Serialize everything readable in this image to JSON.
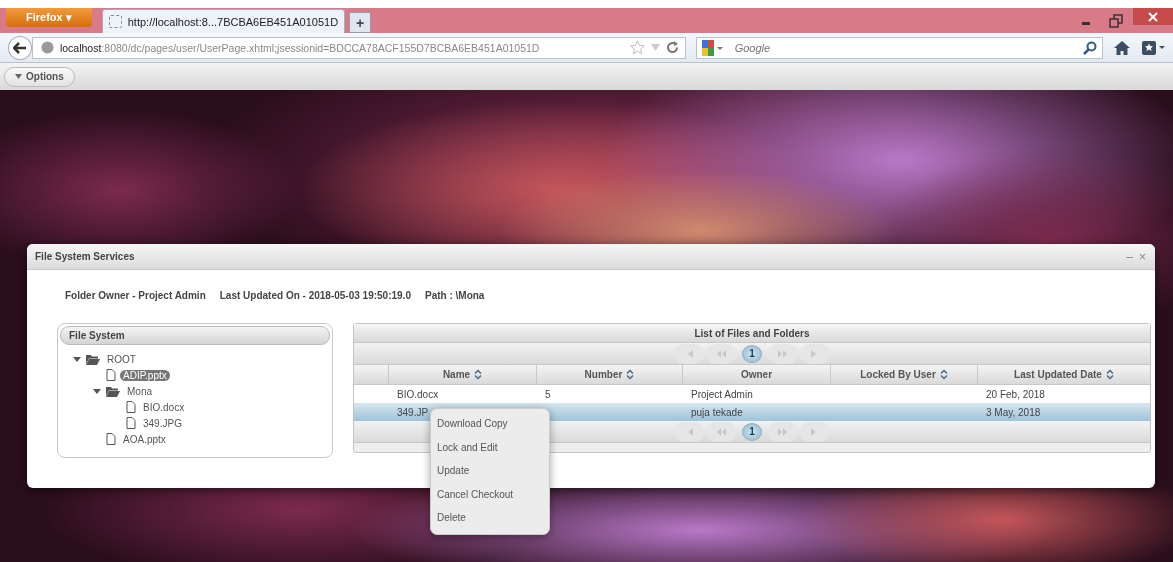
{
  "browser": {
    "menu_button": "Firefox ▾",
    "tab_title": "http://localhost:8...7BCBA6EB451A01051D",
    "new_tab": "+",
    "url_host": "localhost",
    "url_rest": ":8080/dc/pages/user/UserPage.xhtml;jsessionid=BDCCA78ACF155D7BCBA6EB451A01051D",
    "search_placeholder": "Google",
    "options_button": "Options"
  },
  "dialog": {
    "title": "File System Services",
    "controls": [
      "–",
      "×"
    ],
    "info": [
      "Folder Owner - Project Admin",
      "Last Updated On - 2018-05-03 19:50:19.0",
      "Path : \\Mona"
    ],
    "tree": {
      "title": "File System",
      "items": [
        {
          "label": "ROOT",
          "kind": "folder",
          "expanded": true,
          "selected": false,
          "children": [
            {
              "label": "ADIP.pptx",
              "kind": "file",
              "selected": true
            },
            {
              "label": "Mona",
              "kind": "folder",
              "expanded": true,
              "selected": false,
              "children": [
                {
                  "label": "BIO.docx",
                  "kind": "file",
                  "selected": false
                },
                {
                  "label": "349.JPG",
                  "kind": "file",
                  "selected": false
                }
              ]
            },
            {
              "label": "AOA.pptx",
              "kind": "file",
              "selected": false
            }
          ]
        }
      ]
    },
    "table": {
      "title": "List of Files and Folders",
      "pagers": [
        {
          "pages": [
            {
              "label": "1",
              "selected": true
            }
          ]
        },
        {
          "pages": [
            {
              "label": "1",
              "selected": true
            }
          ]
        }
      ],
      "columns": [
        {
          "label": "Name",
          "sortable": true
        },
        {
          "label": "Number",
          "sortable": true
        },
        {
          "label": "Owner",
          "sortable": false
        },
        {
          "label": "Locked By User",
          "sortable": true
        },
        {
          "label": "Last Updated Date",
          "sortable": true
        }
      ],
      "rows": [
        {
          "selected": false,
          "cells": [
            "BIO.docx",
            "5",
            "Project Admin",
            "",
            "20 Feb, 2018"
          ]
        },
        {
          "selected": true,
          "cells": [
            "349.JP",
            "",
            "puja tekade",
            "",
            "3 May, 2018"
          ]
        }
      ]
    },
    "context_menu": [
      "Download Copy",
      "Lock and Edit",
      "Update",
      "Cancel Checkout",
      "Delete"
    ]
  }
}
